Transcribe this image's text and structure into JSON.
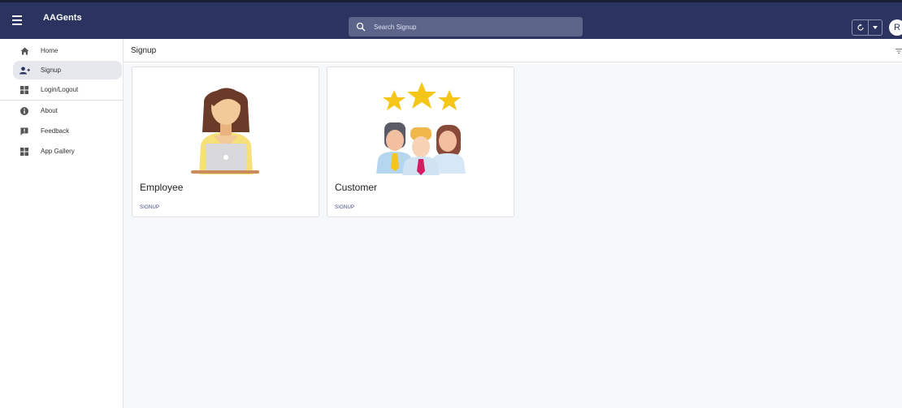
{
  "app": {
    "title": "AAGents"
  },
  "search": {
    "placeholder": "Search Signup"
  },
  "user": {
    "initial": "R"
  },
  "sidebar": {
    "items": [
      {
        "label": "Home",
        "icon": "home-icon"
      },
      {
        "label": "Signup",
        "icon": "add-person-icon",
        "active": true
      },
      {
        "label": "Login/Logout",
        "icon": "grid-icon"
      },
      {
        "label": "About",
        "icon": "info-icon"
      },
      {
        "label": "Feedback",
        "icon": "feedback-icon"
      },
      {
        "label": "App Gallery",
        "icon": "grid-icon"
      }
    ]
  },
  "main": {
    "title": "Signup",
    "cards": [
      {
        "title": "Employee",
        "action": "SIGNUP",
        "image": "woman-with-laptop-illustration"
      },
      {
        "title": "Customer",
        "action": "SIGNUP",
        "image": "three-people-three-stars-illustration"
      }
    ]
  },
  "colors": {
    "topbar": "#2b3460",
    "search_bg": "#5c6489",
    "sidebar_active": "#e6e7ec",
    "main_bg": "#f7f8fa",
    "accent_text": "#3a4275"
  }
}
